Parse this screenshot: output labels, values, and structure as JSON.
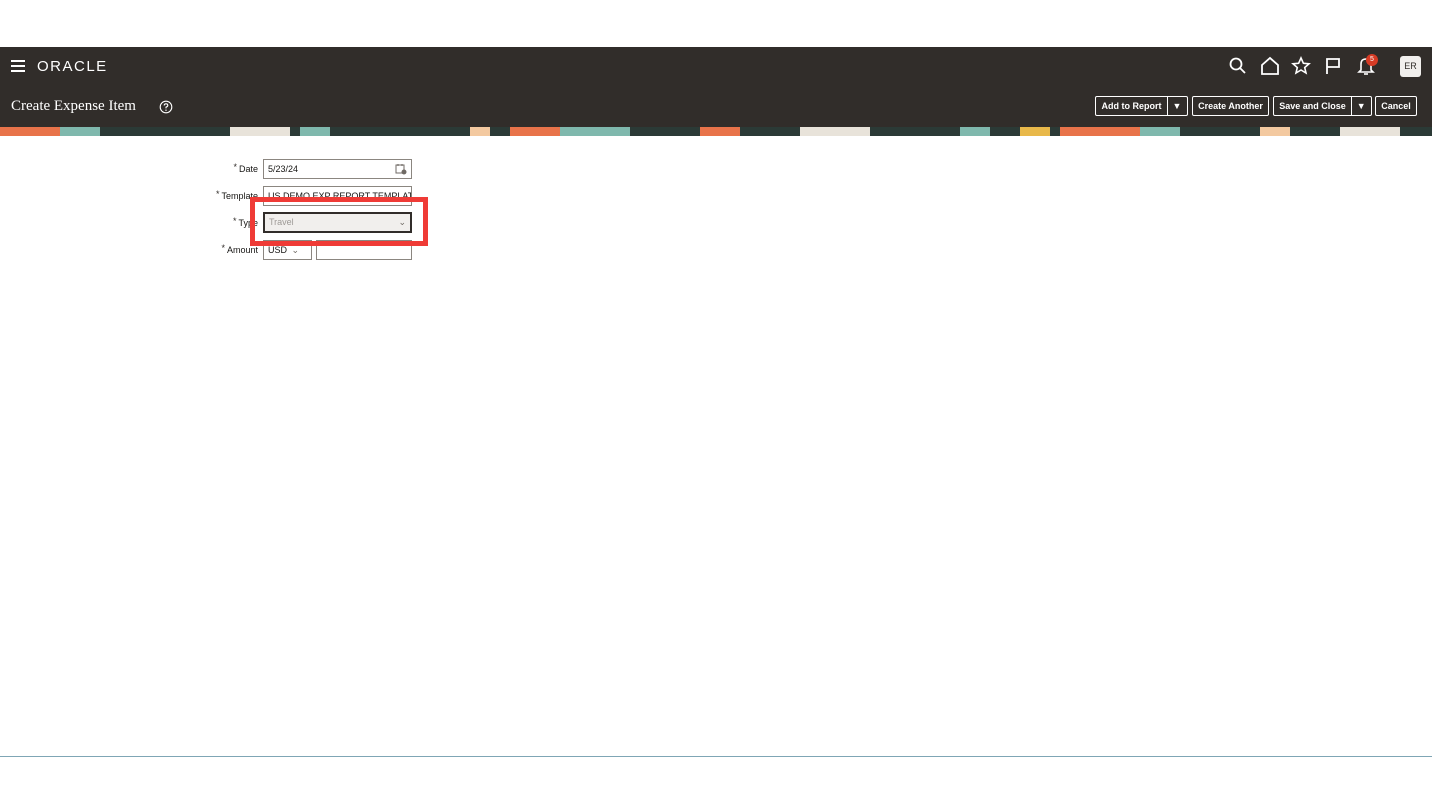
{
  "header": {
    "brand": "ORACLE",
    "notification_count": "5",
    "user_initials": "ER"
  },
  "page": {
    "title": "Create Expense Item"
  },
  "actions": {
    "add_to_report": "Add to Report",
    "create_another": "Create Another",
    "save_and_close": "Save and Close",
    "cancel": "Cancel"
  },
  "form": {
    "date": {
      "label": "Date",
      "value": "5/23/24"
    },
    "template": {
      "label": "Template",
      "value": "US DEMO EXP REPORT TEMPLATE"
    },
    "type": {
      "label": "Type",
      "value": "Travel"
    },
    "amount": {
      "label": "Amount",
      "currency": "USD",
      "value": ""
    }
  },
  "colors": {
    "header_bg": "#312d2a",
    "highlight": "#ef3b36"
  }
}
